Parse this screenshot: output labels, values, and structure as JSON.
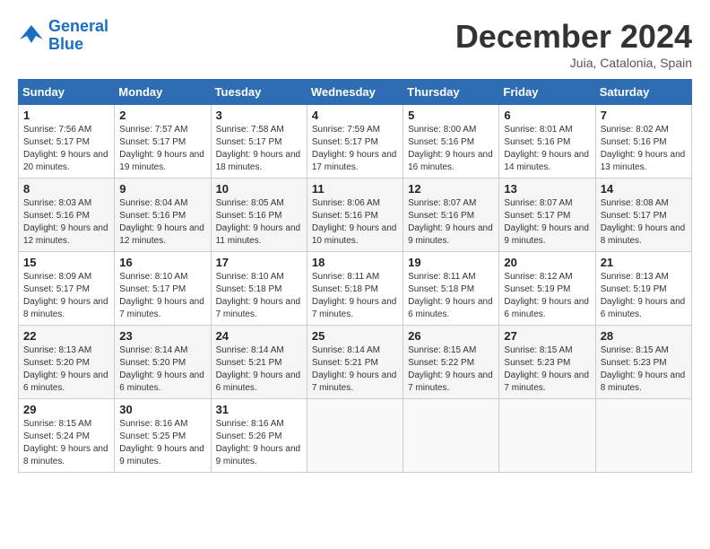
{
  "header": {
    "logo_line1": "General",
    "logo_line2": "Blue",
    "month": "December 2024",
    "location": "Juia, Catalonia, Spain"
  },
  "weekdays": [
    "Sunday",
    "Monday",
    "Tuesday",
    "Wednesday",
    "Thursday",
    "Friday",
    "Saturday"
  ],
  "weeks": [
    [
      {
        "day": "1",
        "sunrise": "7:56 AM",
        "sunset": "5:17 PM",
        "daylight": "9 hours and 20 minutes."
      },
      {
        "day": "2",
        "sunrise": "7:57 AM",
        "sunset": "5:17 PM",
        "daylight": "9 hours and 19 minutes."
      },
      {
        "day": "3",
        "sunrise": "7:58 AM",
        "sunset": "5:17 PM",
        "daylight": "9 hours and 18 minutes."
      },
      {
        "day": "4",
        "sunrise": "7:59 AM",
        "sunset": "5:17 PM",
        "daylight": "9 hours and 17 minutes."
      },
      {
        "day": "5",
        "sunrise": "8:00 AM",
        "sunset": "5:16 PM",
        "daylight": "9 hours and 16 minutes."
      },
      {
        "day": "6",
        "sunrise": "8:01 AM",
        "sunset": "5:16 PM",
        "daylight": "9 hours and 14 minutes."
      },
      {
        "day": "7",
        "sunrise": "8:02 AM",
        "sunset": "5:16 PM",
        "daylight": "9 hours and 13 minutes."
      }
    ],
    [
      {
        "day": "8",
        "sunrise": "8:03 AM",
        "sunset": "5:16 PM",
        "daylight": "9 hours and 12 minutes."
      },
      {
        "day": "9",
        "sunrise": "8:04 AM",
        "sunset": "5:16 PM",
        "daylight": "9 hours and 12 minutes."
      },
      {
        "day": "10",
        "sunrise": "8:05 AM",
        "sunset": "5:16 PM",
        "daylight": "9 hours and 11 minutes."
      },
      {
        "day": "11",
        "sunrise": "8:06 AM",
        "sunset": "5:16 PM",
        "daylight": "9 hours and 10 minutes."
      },
      {
        "day": "12",
        "sunrise": "8:07 AM",
        "sunset": "5:16 PM",
        "daylight": "9 hours and 9 minutes."
      },
      {
        "day": "13",
        "sunrise": "8:07 AM",
        "sunset": "5:17 PM",
        "daylight": "9 hours and 9 minutes."
      },
      {
        "day": "14",
        "sunrise": "8:08 AM",
        "sunset": "5:17 PM",
        "daylight": "9 hours and 8 minutes."
      }
    ],
    [
      {
        "day": "15",
        "sunrise": "8:09 AM",
        "sunset": "5:17 PM",
        "daylight": "9 hours and 8 minutes."
      },
      {
        "day": "16",
        "sunrise": "8:10 AM",
        "sunset": "5:17 PM",
        "daylight": "9 hours and 7 minutes."
      },
      {
        "day": "17",
        "sunrise": "8:10 AM",
        "sunset": "5:18 PM",
        "daylight": "9 hours and 7 minutes."
      },
      {
        "day": "18",
        "sunrise": "8:11 AM",
        "sunset": "5:18 PM",
        "daylight": "9 hours and 7 minutes."
      },
      {
        "day": "19",
        "sunrise": "8:11 AM",
        "sunset": "5:18 PM",
        "daylight": "9 hours and 6 minutes."
      },
      {
        "day": "20",
        "sunrise": "8:12 AM",
        "sunset": "5:19 PM",
        "daylight": "9 hours and 6 minutes."
      },
      {
        "day": "21",
        "sunrise": "8:13 AM",
        "sunset": "5:19 PM",
        "daylight": "9 hours and 6 minutes."
      }
    ],
    [
      {
        "day": "22",
        "sunrise": "8:13 AM",
        "sunset": "5:20 PM",
        "daylight": "9 hours and 6 minutes."
      },
      {
        "day": "23",
        "sunrise": "8:14 AM",
        "sunset": "5:20 PM",
        "daylight": "9 hours and 6 minutes."
      },
      {
        "day": "24",
        "sunrise": "8:14 AM",
        "sunset": "5:21 PM",
        "daylight": "9 hours and 6 minutes."
      },
      {
        "day": "25",
        "sunrise": "8:14 AM",
        "sunset": "5:21 PM",
        "daylight": "9 hours and 7 minutes."
      },
      {
        "day": "26",
        "sunrise": "8:15 AM",
        "sunset": "5:22 PM",
        "daylight": "9 hours and 7 minutes."
      },
      {
        "day": "27",
        "sunrise": "8:15 AM",
        "sunset": "5:23 PM",
        "daylight": "9 hours and 7 minutes."
      },
      {
        "day": "28",
        "sunrise": "8:15 AM",
        "sunset": "5:23 PM",
        "daylight": "9 hours and 8 minutes."
      }
    ],
    [
      {
        "day": "29",
        "sunrise": "8:15 AM",
        "sunset": "5:24 PM",
        "daylight": "9 hours and 8 minutes."
      },
      {
        "day": "30",
        "sunrise": "8:16 AM",
        "sunset": "5:25 PM",
        "daylight": "9 hours and 9 minutes."
      },
      {
        "day": "31",
        "sunrise": "8:16 AM",
        "sunset": "5:26 PM",
        "daylight": "9 hours and 9 minutes."
      },
      null,
      null,
      null,
      null
    ]
  ]
}
